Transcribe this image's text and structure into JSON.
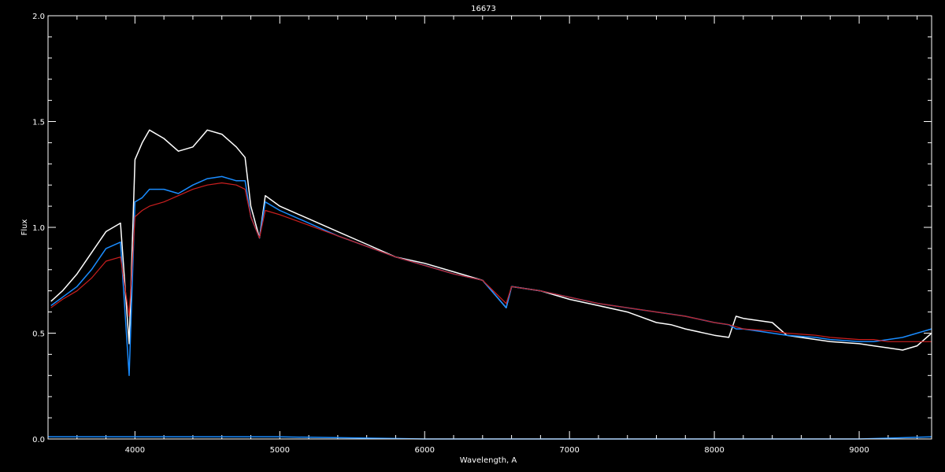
{
  "colors": {
    "background": "#000000",
    "axes": "#ffffff",
    "observed_white": "#ffffff",
    "observed_blue": "#1a8cff",
    "model_red": "#cc1f1f"
  },
  "chart_data": {
    "type": "line",
    "title": "16673",
    "xlabel": "Wavelength, A",
    "ylabel": "Flux",
    "xlim": [
      3400,
      9500
    ],
    "ylim": [
      0.0,
      2.0
    ],
    "x_ticks": [
      4000,
      5000,
      6000,
      7000,
      8000,
      9000
    ],
    "y_ticks": [
      "0.0",
      "0.5",
      "1.0",
      "1.5",
      "2.0"
    ],
    "grid": false,
    "series": [
      {
        "color": "#ffffff",
        "x": [
          3420,
          3500,
          3600,
          3700,
          3800,
          3900,
          3960,
          4000,
          4050,
          4100,
          4200,
          4300,
          4400,
          4500,
          4600,
          4700,
          4760,
          4800,
          4860,
          4900,
          5000,
          5200,
          5400,
          5600,
          5800,
          6000,
          6200,
          6400,
          6563,
          6600,
          6800,
          7000,
          7200,
          7400,
          7600,
          7700,
          7800,
          8000,
          8100,
          8150,
          8200,
          8400,
          8500,
          8700,
          8800,
          9000,
          9100,
          9200,
          9300,
          9400,
          9500
        ],
        "y": [
          0.65,
          0.7,
          0.78,
          0.88,
          0.98,
          1.02,
          0.45,
          1.32,
          1.4,
          1.46,
          1.42,
          1.36,
          1.38,
          1.46,
          1.44,
          1.38,
          1.33,
          1.1,
          0.95,
          1.15,
          1.1,
          1.04,
          0.98,
          0.92,
          0.86,
          0.83,
          0.79,
          0.75,
          0.62,
          0.72,
          0.7,
          0.66,
          0.63,
          0.6,
          0.55,
          0.54,
          0.52,
          0.49,
          0.48,
          0.58,
          0.57,
          0.55,
          0.49,
          0.47,
          0.46,
          0.45,
          0.44,
          0.43,
          0.42,
          0.44,
          0.5
        ]
      },
      {
        "color": "#1a8cff",
        "x": [
          3420,
          3500,
          3600,
          3700,
          3800,
          3900,
          3960,
          4000,
          4050,
          4100,
          4200,
          4300,
          4400,
          4500,
          4600,
          4700,
          4760,
          4800,
          4860,
          4900,
          5000,
          5200,
          5400,
          5600,
          5800,
          6000,
          6200,
          6400,
          6563,
          6600,
          6800,
          7000,
          7200,
          7400,
          7600,
          7700,
          7800,
          8000,
          8100,
          8150,
          8200,
          8400,
          8500,
          8700,
          8800,
          9000,
          9100,
          9200,
          9300,
          9400,
          9500
        ],
        "y": [
          0.63,
          0.67,
          0.72,
          0.8,
          0.9,
          0.93,
          0.3,
          1.12,
          1.14,
          1.18,
          1.18,
          1.16,
          1.2,
          1.23,
          1.24,
          1.22,
          1.22,
          1.05,
          0.95,
          1.12,
          1.08,
          1.02,
          0.96,
          0.91,
          0.86,
          0.82,
          0.78,
          0.75,
          0.62,
          0.72,
          0.7,
          0.67,
          0.64,
          0.62,
          0.6,
          0.59,
          0.58,
          0.55,
          0.54,
          0.52,
          0.52,
          0.5,
          0.49,
          0.48,
          0.47,
          0.46,
          0.46,
          0.47,
          0.48,
          0.5,
          0.52
        ]
      },
      {
        "color": "#cc1f1f",
        "x": [
          3420,
          3500,
          3600,
          3700,
          3800,
          3900,
          3960,
          4000,
          4050,
          4100,
          4200,
          4300,
          4400,
          4500,
          4600,
          4700,
          4760,
          4800,
          4860,
          4900,
          5000,
          5200,
          5400,
          5600,
          5800,
          6000,
          6200,
          6400,
          6563,
          6600,
          6800,
          7000,
          7200,
          7400,
          7600,
          7700,
          7800,
          8000,
          8100,
          8150,
          8200,
          8400,
          8500,
          8700,
          8800,
          9000,
          9100,
          9200,
          9300,
          9400,
          9500
        ],
        "y": [
          0.62,
          0.66,
          0.7,
          0.76,
          0.84,
          0.86,
          0.58,
          1.05,
          1.08,
          1.1,
          1.12,
          1.15,
          1.18,
          1.2,
          1.21,
          1.2,
          1.18,
          1.05,
          0.95,
          1.08,
          1.06,
          1.01,
          0.96,
          0.91,
          0.86,
          0.82,
          0.78,
          0.75,
          0.64,
          0.72,
          0.7,
          0.67,
          0.64,
          0.62,
          0.6,
          0.59,
          0.58,
          0.55,
          0.54,
          0.53,
          0.52,
          0.51,
          0.5,
          0.49,
          0.48,
          0.47,
          0.47,
          0.46,
          0.46,
          0.46,
          0.46
        ]
      },
      {
        "color": "#1a8cff",
        "x": [
          3400,
          4000,
          5000,
          6000,
          7000,
          8000,
          9000,
          9500
        ],
        "y": [
          0.01,
          0.01,
          0.01,
          0.0,
          0.0,
          0.0,
          0.0,
          0.01
        ]
      }
    ]
  }
}
